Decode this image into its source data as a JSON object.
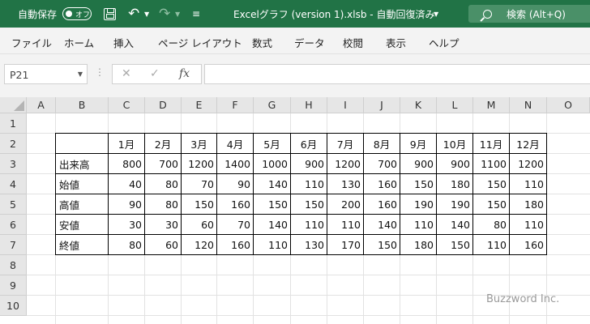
{
  "titlebar": {
    "autosave_label": "自動保存",
    "autosave_state": "オフ",
    "qat_more": "≡",
    "doc_title": "Excelグラフ (version 1).xlsb  -  自動回復済み",
    "search_text": "検索 (Alt+Q)"
  },
  "menu": [
    "ファイル",
    "ホーム",
    "挿入",
    "ページ レイアウト",
    "数式",
    "データ",
    "校閲",
    "表示",
    "ヘルプ"
  ],
  "formula_bar": {
    "name_box": "P21",
    "formula": ""
  },
  "columns": [
    "A",
    "B",
    "C",
    "D",
    "E",
    "F",
    "G",
    "H",
    "I",
    "J",
    "K",
    "L",
    "M",
    "N",
    "O"
  ],
  "rows": [
    "1",
    "2",
    "3",
    "4",
    "5",
    "6",
    "7",
    "8",
    "9",
    "10"
  ],
  "table": {
    "months": [
      "1月",
      "2月",
      "3月",
      "4月",
      "5月",
      "6月",
      "7月",
      "8月",
      "9月",
      "10月",
      "11月",
      "12月"
    ],
    "rows": [
      {
        "label": "出来高",
        "values": [
          "800",
          "700",
          "1200",
          "1400",
          "1000",
          "900",
          "1200",
          "700",
          "900",
          "900",
          "1100",
          "1200"
        ]
      },
      {
        "label": "始値",
        "values": [
          "40",
          "80",
          "70",
          "90",
          "140",
          "110",
          "130",
          "160",
          "150",
          "180",
          "150",
          "110"
        ]
      },
      {
        "label": "高値",
        "values": [
          "90",
          "80",
          "150",
          "160",
          "150",
          "150",
          "200",
          "160",
          "190",
          "190",
          "150",
          "180"
        ]
      },
      {
        "label": "安値",
        "values": [
          "30",
          "30",
          "60",
          "70",
          "140",
          "110",
          "110",
          "140",
          "110",
          "140",
          "80",
          "110"
        ]
      },
      {
        "label": "終値",
        "values": [
          "80",
          "60",
          "120",
          "160",
          "110",
          "130",
          "170",
          "150",
          "180",
          "150",
          "110",
          "160"
        ]
      }
    ]
  },
  "watermark": "Buzzword Inc."
}
